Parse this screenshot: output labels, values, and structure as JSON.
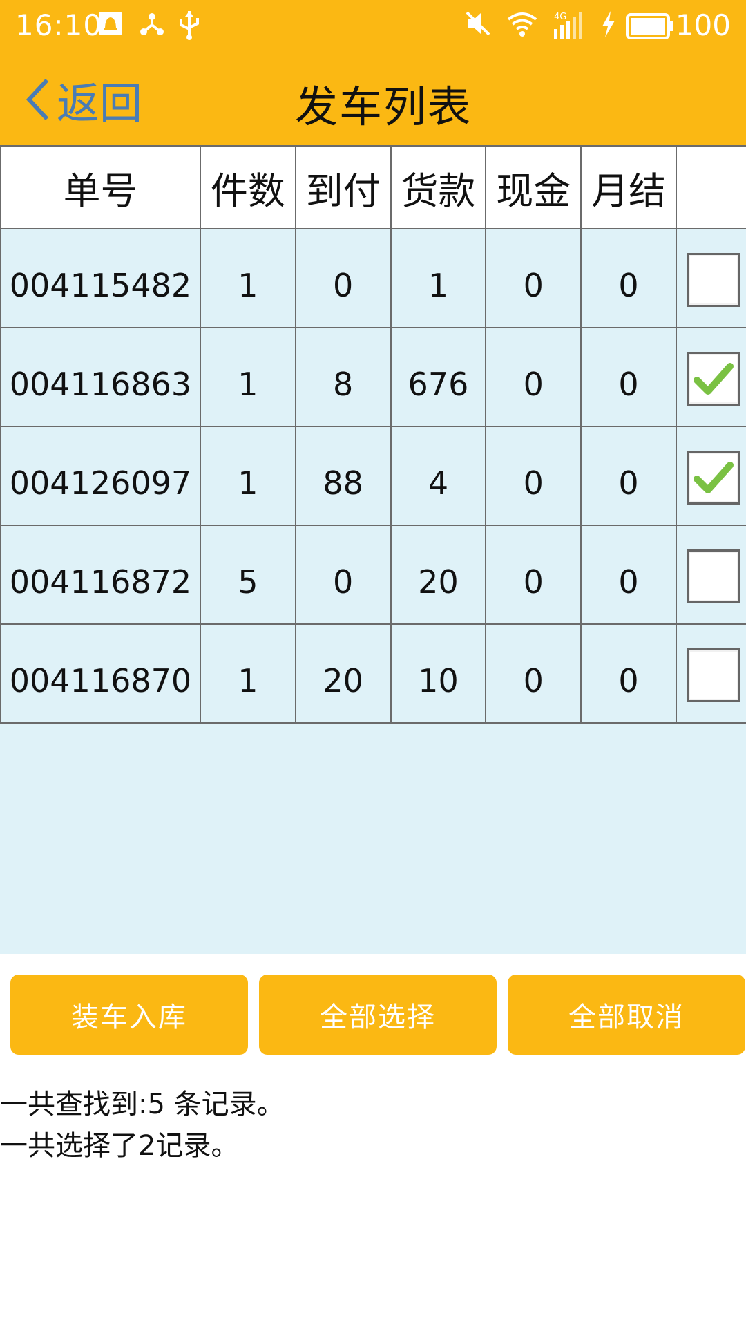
{
  "status_bar": {
    "time": "16:10",
    "battery": "100",
    "icons": [
      "notification-icon",
      "share-icon",
      "usb-icon",
      "mute-icon",
      "wifi-icon",
      "signal-4g-icon",
      "charging-icon",
      "battery-icon"
    ]
  },
  "header": {
    "back_label": "返回",
    "title": "发车列表"
  },
  "table": {
    "columns": [
      "单号",
      "件数",
      "到付",
      "货款",
      "现金",
      "月结"
    ],
    "rows": [
      {
        "order": "004115482",
        "pieces": "1",
        "cod": "0",
        "goods": "1",
        "cash": "0",
        "monthly": "0",
        "checked": false
      },
      {
        "order": "004116863",
        "pieces": "1",
        "cod": "8",
        "goods": "676",
        "cash": "0",
        "monthly": "0",
        "checked": true
      },
      {
        "order": "004126097",
        "pieces": "1",
        "cod": "88",
        "goods": "4",
        "cash": "0",
        "monthly": "0",
        "checked": true
      },
      {
        "order": "004116872",
        "pieces": "5",
        "cod": "0",
        "goods": "20",
        "cash": "0",
        "monthly": "0",
        "checked": false
      },
      {
        "order": "004116870",
        "pieces": "1",
        "cod": "20",
        "goods": "10",
        "cash": "0",
        "monthly": "0",
        "checked": false
      }
    ]
  },
  "buttons": {
    "load": "装车入库",
    "select_all": "全部选择",
    "cancel_all": "全部取消"
  },
  "summary": {
    "found": "一共查找到:5 条记录。",
    "selected": "一共选择了2记录。"
  },
  "colors": {
    "accent": "#FBB813",
    "table_bg": "#DFF2F8",
    "back_text": "#4A7CB4",
    "check": "#7AC143"
  }
}
